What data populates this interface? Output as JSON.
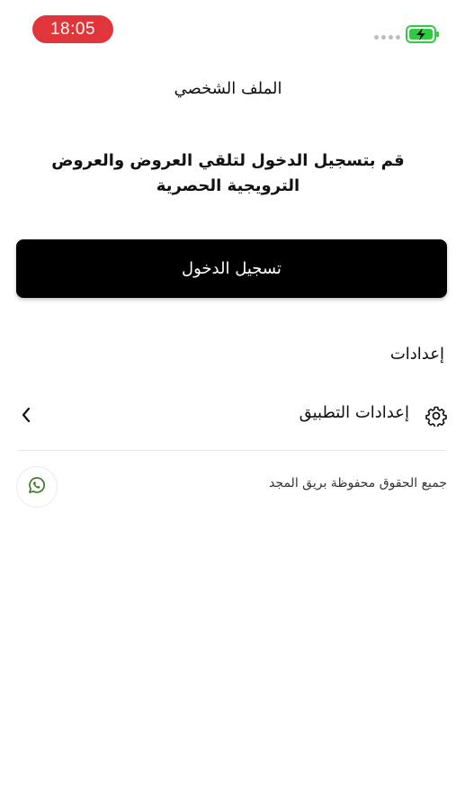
{
  "status_bar": {
    "time": "18:05",
    "icons": [
      "signal-dots-icon",
      "battery-charging-icon"
    ],
    "time_pill_color": "#e0353a",
    "battery_color": "#2ecc40"
  },
  "header": {
    "title": "الملف الشخصي"
  },
  "prompt": {
    "text": "قم بتسجيل الدخول لتلقي العروض والعروض الترويجية الحصرية"
  },
  "login_button": {
    "label": "تسجيل الدخول"
  },
  "settings_section": {
    "title": "إعدادات",
    "items": [
      {
        "label": "إعدادات التطبيق",
        "icon": "gear-icon",
        "trailing_icon": "chevron-left-icon"
      }
    ]
  },
  "footer": {
    "copyright": "جميع الحقوق محفوظة بريق المجد",
    "whatsapp_icon": "whatsapp-icon",
    "whatsapp_color": "#3a7d2a"
  }
}
